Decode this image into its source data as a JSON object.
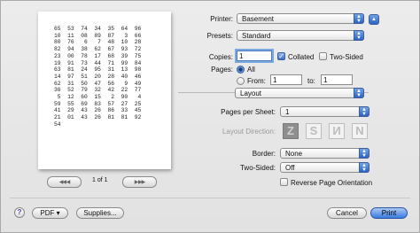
{
  "preview": {
    "number_lines": [
      "65  53  74  34  35  64  96",
      "10  11  08  89  87   3  66",
      "80  76   6   7  48  10  28",
      "82  94  38  62  67  93  72",
      "23  00  78  17  68  39  75",
      "19  91  73  44  71  99  84",
      "63  81  24  95  31  13  98",
      "14  97  51  20  28  40  46",
      "62  31  50  47  56   9  49",
      "36  52  79  32  42  22  77",
      " 5  12  60  15   2  90   4",
      "59  55  69  83  57  27  25",
      "41  29  43  26  86  33  45",
      "21  01  43  26  81  81  92",
      "54"
    ],
    "page_indicator": "1 of 1",
    "first_prev": "◀◀ ◀",
    "next_last": "▶ ▶▶"
  },
  "printer": {
    "label": "Printer:",
    "value": "Basement"
  },
  "presets": {
    "label": "Presets:",
    "value": "Standard"
  },
  "copies": {
    "label": "Copies:",
    "value": "1",
    "collated_label": "Collated",
    "collated": true,
    "two_sided_label": "Two-Sided",
    "two_sided": false
  },
  "pages": {
    "label": "Pages:",
    "all_label": "All",
    "from_label": "From:",
    "from_value": "1",
    "to_label": "to:",
    "to_value": "1"
  },
  "panel_popup": {
    "value": "Layout"
  },
  "layout": {
    "pages_per_sheet_label": "Pages per Sheet:",
    "pages_per_sheet_value": "1",
    "direction_label": "Layout Direction:",
    "directions": [
      "Z",
      "S",
      "И",
      "N"
    ],
    "border_label": "Border:",
    "border_value": "None",
    "two_sided_label": "Two-Sided:",
    "two_sided_value": "Off",
    "reverse_label": "Reverse Page Orientation",
    "reverse": false
  },
  "buttons": {
    "help": "?",
    "pdf": "PDF ▾",
    "supplies": "Supplies...",
    "cancel": "Cancel",
    "print": "Print"
  }
}
